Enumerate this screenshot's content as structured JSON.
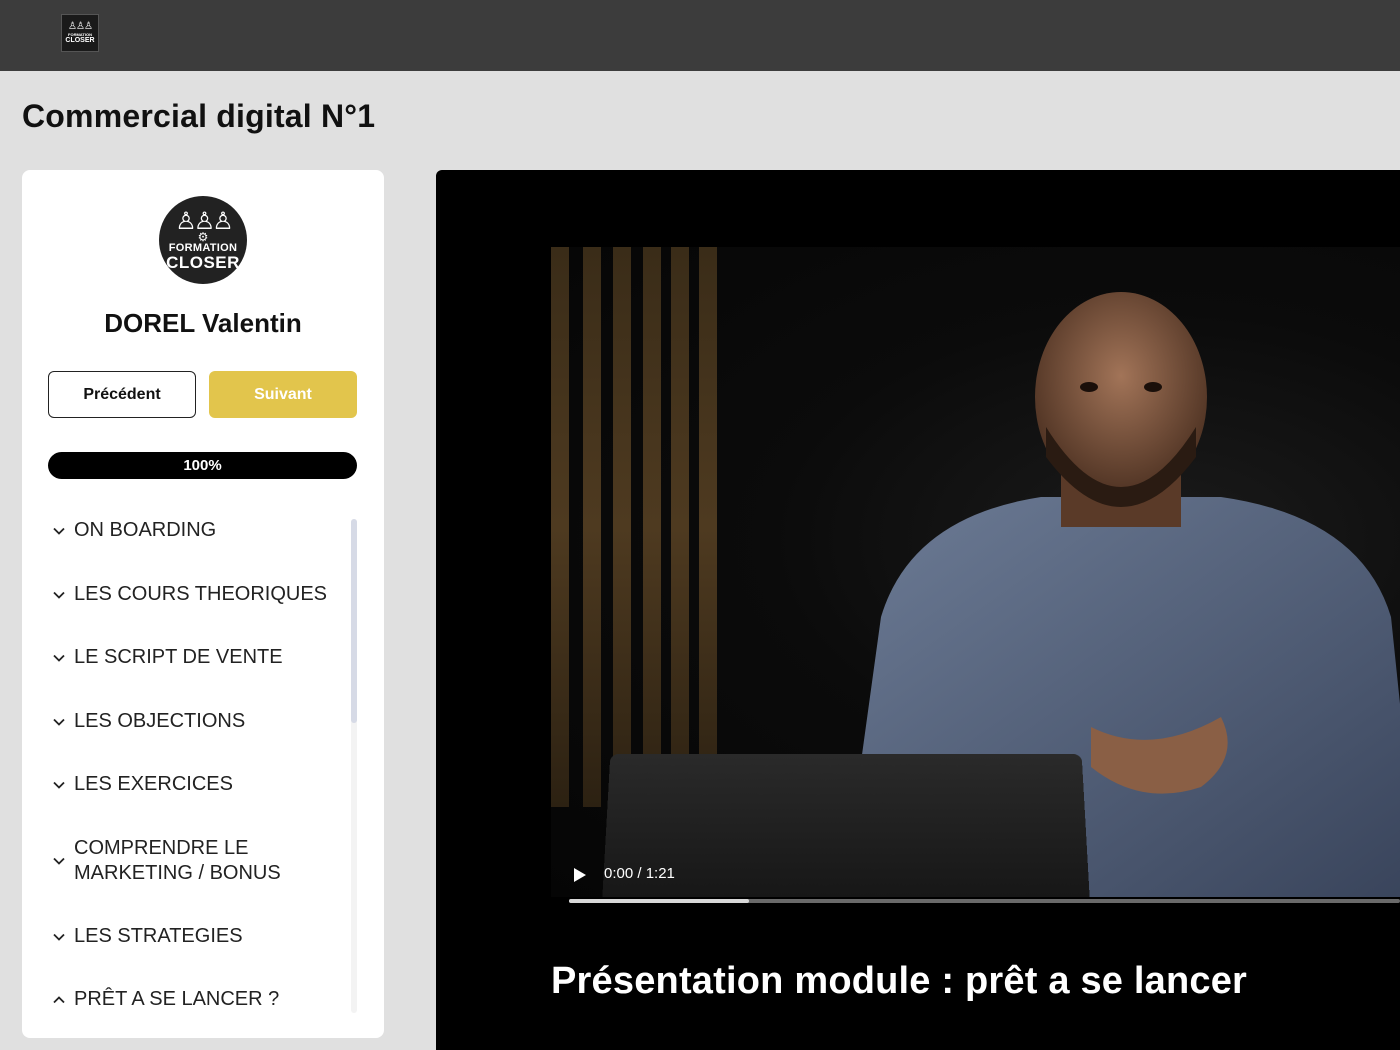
{
  "header": {
    "logo": {
      "line1": "FORMATION",
      "line2": "CLOSER",
      "icon": "team-icon"
    }
  },
  "page": {
    "title": "Commercial digital N°1"
  },
  "sidebar": {
    "logo": {
      "line1": "FORMATION",
      "line2": "CLOSER",
      "icon": "team-icon"
    },
    "user_name": "DOREL Valentin",
    "prev_label": "Précédent",
    "next_label": "Suivant",
    "next_color": "#e2c54c",
    "progress_label": "100%",
    "progress": 1.0,
    "modules": [
      {
        "label": "ON BOARDING",
        "icon": "chevron-down-icon"
      },
      {
        "label": "LES COURS THEORIQUES",
        "icon": "chevron-down-icon"
      },
      {
        "label": "LE SCRIPT DE VENTE",
        "icon": "chevron-down-icon"
      },
      {
        "label": "LES OBJECTIONS",
        "icon": "chevron-down-icon"
      },
      {
        "label": "LES EXERCICES",
        "icon": "chevron-down-icon"
      },
      {
        "label": "COMPRENDRE LE MARKETING / BONUS",
        "icon": "chevron-down-icon"
      },
      {
        "label": "LES STRATEGIES",
        "icon": "chevron-down-icon"
      },
      {
        "label": "PRÊT A SE LANCER ?",
        "icon": "chevron-up-icon"
      }
    ]
  },
  "video": {
    "time": "0:00 / 1:21",
    "title": "Présentation module : prêt a se lancer",
    "play_icon": "play-icon"
  }
}
